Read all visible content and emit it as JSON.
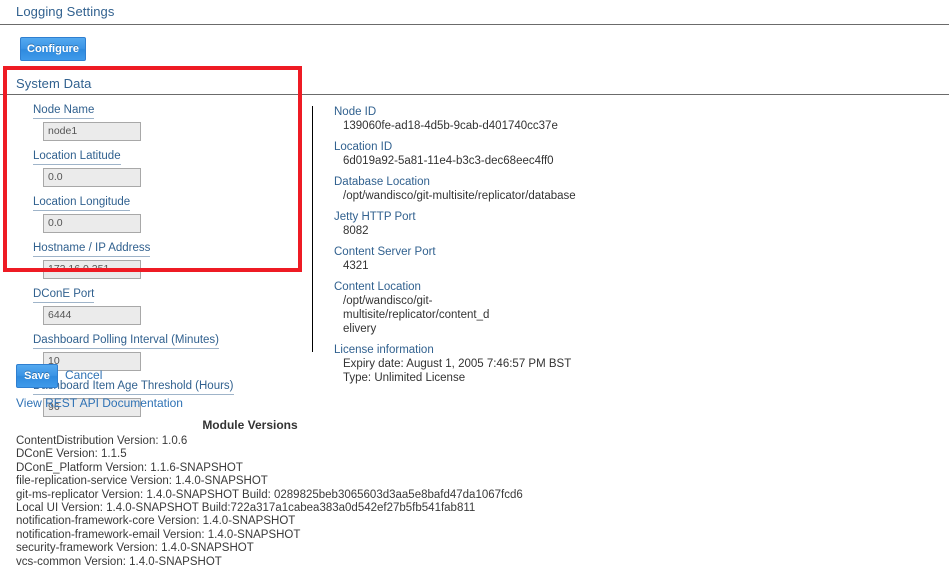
{
  "logging": {
    "heading": "Logging Settings",
    "configure_label": "Configure"
  },
  "system_data": {
    "heading": "System Data"
  },
  "form": {
    "fields": [
      {
        "label": "Node Name",
        "value": "node1"
      },
      {
        "label": "Location Latitude",
        "value": "0.0"
      },
      {
        "label": "Location Longitude",
        "value": "0.0"
      },
      {
        "label": "Hostname / IP Address",
        "value": "172.16.0.251"
      },
      {
        "label": "DConE Port",
        "value": "6444"
      },
      {
        "label": "Dashboard Polling Interval (Minutes)",
        "value": "10"
      },
      {
        "label": "Dashboard Item Age Threshold (Hours)",
        "value": "96"
      }
    ]
  },
  "info": {
    "items": [
      {
        "label": "Node ID",
        "value": "139060fe-ad18-4d5b-9cab-d401740cc37e"
      },
      {
        "label": "Location ID",
        "value": "6d019a92-5a81-11e4-b3c3-dec68eec4ff0"
      },
      {
        "label": "Database Location",
        "value": "/opt/wandisco/git-multisite/replicator/database"
      },
      {
        "label": "Jetty HTTP Port",
        "value": "8082"
      },
      {
        "label": "Content Server Port",
        "value": "4321"
      },
      {
        "label": "Content Location",
        "value": "/opt/wandisco/git-multisite/replicator/content_delivery"
      },
      {
        "label": "License information",
        "value": "Expiry date: August 1, 2005 7:46:57 PM BST\nType: Unlimited License"
      }
    ]
  },
  "actions": {
    "save_label": "Save",
    "cancel_label": "Cancel",
    "rest_api_label": "View REST API Documentation"
  },
  "module_versions": {
    "title": "Module Versions",
    "lines": [
      "ContentDistribution Version: 1.0.6",
      "DConE Version: 1.1.5",
      "DConE_Platform Version: 1.1.6-SNAPSHOT",
      "file-replication-service Version: 1.4.0-SNAPSHOT",
      "git-ms-replicator Version: 1.4.0-SNAPSHOT Build: 0289825beb3065603d3aa5e8bafd47da1067fcd6",
      "Local UI Version: 1.4.0-SNAPSHOT Build:722a317a1cabea383a0d542ef27b5fb541fab811",
      "notification-framework-core Version: 1.4.0-SNAPSHOT",
      "notification-framework-email Version: 1.4.0-SNAPSHOT",
      "security-framework Version: 1.4.0-SNAPSHOT",
      "vcs-common Version: 1.4.0-SNAPSHOT"
    ]
  },
  "annotation": {
    "highlight_color": "#ee1b24"
  }
}
